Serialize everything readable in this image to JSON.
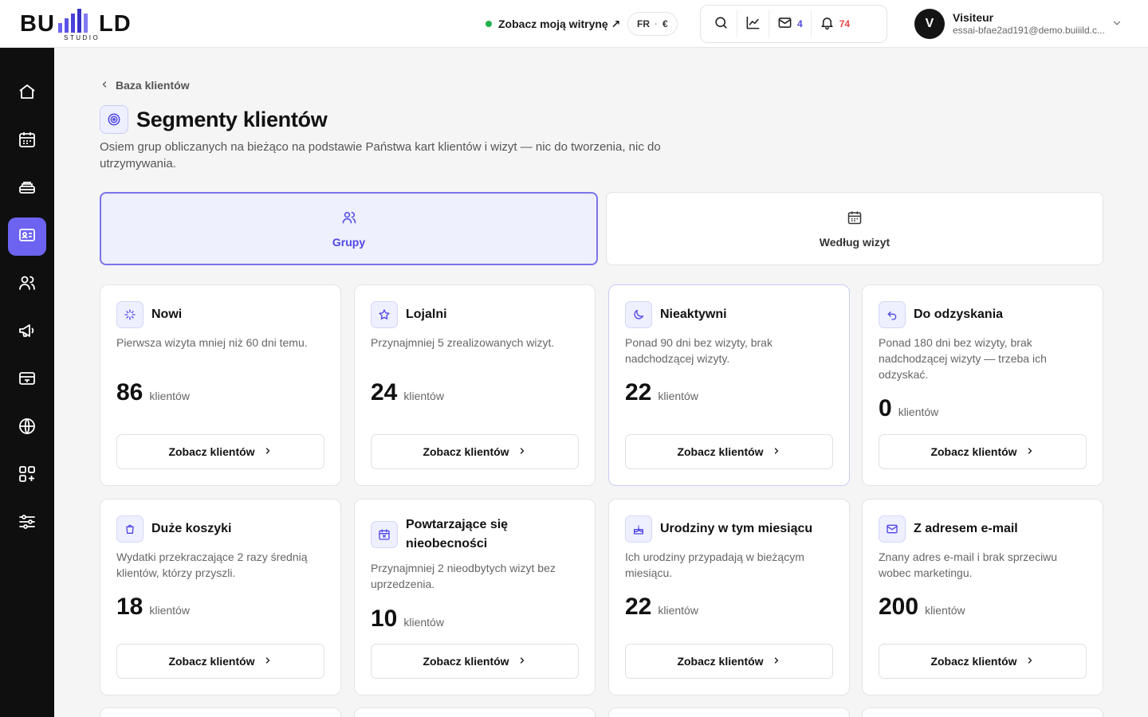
{
  "header": {
    "logo_text": "BUILD",
    "logo_sub": "STUDIO",
    "site_link": "Zobacz moją witrynę ↗",
    "lang": "FR",
    "currency": "€",
    "messages_count": "4",
    "notifications_count": "74",
    "user_initial": "V",
    "user_name": "Visiteur",
    "user_email": "essai-bfae2ad191@demo.buiiild.c..."
  },
  "colors": {
    "accent": "#6c63f0",
    "accent_text": "#4f46e5",
    "status_green": "#22b14c",
    "alert_red": "#e54848"
  },
  "breadcrumb": "Baza klientów",
  "page": {
    "title": "Segmenty klientów",
    "description": "Osiem grup obliczanych na bieżąco na podstawie Państwa kart klientów i wizyt — nic do tworzenia, nic do utrzymywania."
  },
  "tabs": [
    {
      "label": "Grupy",
      "icon": "users-icon",
      "active": true
    },
    {
      "label": "Według wizyt",
      "icon": "calendar-icon",
      "active": false
    }
  ],
  "segments": [
    {
      "title": "Nowi",
      "icon": "sparkle-icon",
      "description": "Pierwsza wizyta mniej niż 60 dni temu.",
      "count": "86",
      "unit": "klientów",
      "button": "Zobacz klientów"
    },
    {
      "title": "Lojalni",
      "icon": "star-icon",
      "description": "Przynajmniej 5 zrealizowanych wizyt.",
      "count": "24",
      "unit": "klientów",
      "button": "Zobacz klientów"
    },
    {
      "title": "Nieaktywni",
      "icon": "moon-icon",
      "description": "Ponad 90 dni bez wizyty, brak nadchodzącej wizyty.",
      "count": "22",
      "unit": "klientów",
      "button": "Zobacz klientów"
    },
    {
      "title": "Do odzyskania",
      "icon": "undo-icon",
      "description": "Ponad 180 dni bez wizyty, brak nadchodzącej wizyty — trzeba ich odzyskać.",
      "count": "0",
      "unit": "klientów",
      "button": "Zobacz klientów"
    },
    {
      "title": "Duże koszyki",
      "icon": "shopping-bag-icon",
      "description": "Wydatki przekraczające 2 razy średnią klientów, którzy przyszli.",
      "count": "18",
      "unit": "klientów",
      "button": "Zobacz klientów"
    },
    {
      "title": "Powtarzające się nieobecności",
      "icon": "calendar-x-icon",
      "description": "Przynajmniej 2 nieodbytych wizyt bez uprzedzenia.",
      "count": "10",
      "unit": "klientów",
      "button": "Zobacz klientów"
    },
    {
      "title": "Urodziny w tym miesiącu",
      "icon": "cake-icon",
      "description": "Ich urodziny przypadają w bieżącym miesiącu.",
      "count": "22",
      "unit": "klientów",
      "button": "Zobacz klientów"
    },
    {
      "title": "Z adresem e-mail",
      "icon": "mail-icon",
      "description": "Znany adres e-mail i brak sprzeciwu wobec marketingu.",
      "count": "200",
      "unit": "klientów",
      "button": "Zobacz klientów"
    }
  ],
  "sidebar": [
    {
      "icon": "home-icon"
    },
    {
      "icon": "calendar-icon"
    },
    {
      "icon": "stack-icon"
    },
    {
      "icon": "contact-card-icon",
      "active": true
    },
    {
      "icon": "users-icon"
    },
    {
      "icon": "megaphone-icon"
    },
    {
      "icon": "register-icon"
    },
    {
      "icon": "globe-icon"
    },
    {
      "icon": "apps-icon"
    },
    {
      "icon": "sliders-icon"
    }
  ]
}
